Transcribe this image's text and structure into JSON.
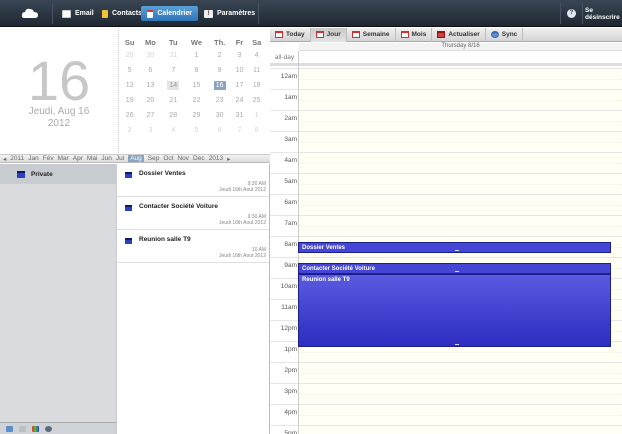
{
  "nav": {
    "email": "Email",
    "contacts": "Contacts",
    "calendar": "Calendrier",
    "settings": "Paramètres",
    "help": "?",
    "logout": "Se désinscrire"
  },
  "bigdate": {
    "day": "16",
    "weekday_date": "Jeudi, Aug 16",
    "year": "2012"
  },
  "minical": {
    "headers": [
      "Su",
      "Mo",
      "Tu",
      "We",
      "Th.",
      "Fr",
      "Sa"
    ],
    "weeks": [
      [
        "29",
        "30",
        "31",
        "1",
        "2",
        "3",
        "4"
      ],
      [
        "5",
        "6",
        "7",
        "8",
        "9",
        "10",
        "11"
      ],
      [
        "12",
        "13",
        "14",
        "15",
        "16",
        "17",
        "18"
      ],
      [
        "19",
        "20",
        "21",
        "22",
        "23",
        "24",
        "25"
      ],
      [
        "26",
        "27",
        "28",
        "29",
        "30",
        "31",
        "1"
      ],
      [
        "2",
        "3",
        "4",
        "5",
        "6",
        "7",
        "8"
      ]
    ]
  },
  "months": {
    "prev_year": "2011",
    "next_year": "2013",
    "list": [
      "Jan",
      "Fév",
      "Mar",
      "Apr",
      "Mai",
      "Jun",
      "Jul",
      "Aug",
      "Sep",
      "Oct",
      "Nov",
      "Dec"
    ],
    "current": "Aug"
  },
  "calendars": [
    {
      "name": "Private"
    }
  ],
  "events_list": [
    {
      "title": "Dossier Ventes",
      "time": "9:30 AM",
      "date": "Jeudi 16th Aout 2012"
    },
    {
      "title": "Contacter Société Voiture",
      "time": "9:30 AM",
      "date": "Jeudi 16th Aout 2012"
    },
    {
      "title": "Reunion salle T9",
      "time": "10 AM",
      "date": "Jeudi 16th Aout 2012"
    }
  ],
  "toolbar": {
    "today": "Today",
    "day": "Jour",
    "week": "Semaine",
    "month": "Mois",
    "refresh": "Actualiser",
    "sync": "Sync"
  },
  "dayview": {
    "header": "Thursday 8/16",
    "allday_label": "all-day",
    "hours": [
      "12am",
      "1am",
      "2am",
      "3am",
      "4am",
      "5am",
      "6am",
      "7am",
      "8am",
      "9am",
      "10am",
      "11am",
      "12pm",
      "1pm",
      "2pm",
      "3pm",
      "4pm",
      "5pm"
    ],
    "events": [
      {
        "title": "Dossier Ventes",
        "start_hour": 8.3,
        "end_hour": 8.8
      },
      {
        "title": "Contacter Société Voiture",
        "start_hour": 9.3,
        "end_hour": 9.8
      },
      {
        "title": "Reunion salle T9",
        "start_hour": 9.8,
        "end_hour": 13.3
      }
    ]
  },
  "colors": {
    "accent": "#2f73b5",
    "event": "#3e3fd0",
    "calendar": "#2b3fc0"
  }
}
